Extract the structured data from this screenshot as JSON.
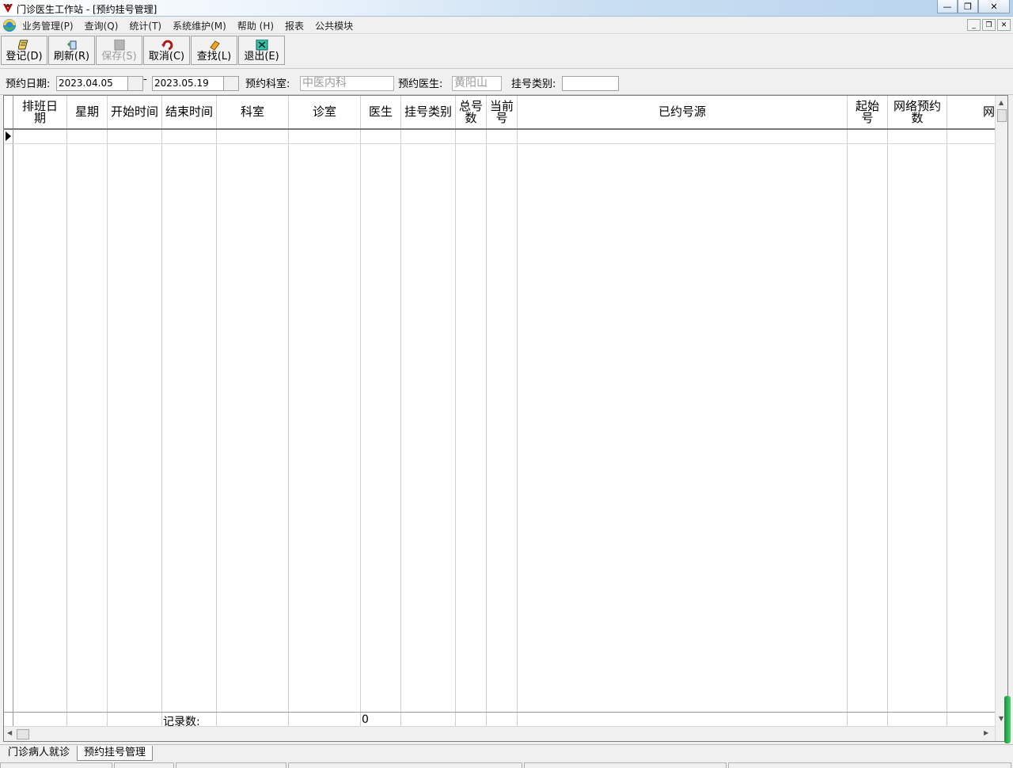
{
  "window": {
    "title": "门诊医生工作站 - [预约挂号管理]"
  },
  "menu": {
    "items": [
      "业务管理(P)",
      "查询(Q)",
      "统计(T)",
      "系统维护(M)",
      "帮助 (H)",
      "报表",
      "公共模块"
    ]
  },
  "toolbar": {
    "buttons": [
      {
        "label": "登记(D)",
        "icon": "register-icon",
        "enabled": true
      },
      {
        "label": "刷新(R)",
        "icon": "refresh-icon",
        "enabled": true
      },
      {
        "label": "保存(S)",
        "icon": "save-icon",
        "enabled": false
      },
      {
        "label": "取消(C)",
        "icon": "undo-icon",
        "enabled": true
      },
      {
        "label": "查找(L)",
        "icon": "eraser-icon",
        "enabled": true
      },
      {
        "label": "退出(E)",
        "icon": "exit-icon",
        "enabled": true
      }
    ]
  },
  "filter": {
    "date_label": "预约日期:",
    "date_from": "2023.04.05",
    "date_separator": "-",
    "date_to": "2023.05.19",
    "dept_label": "预约科室:",
    "dept_value": "中医内科",
    "doctor_label": "预约医生:",
    "doctor_value": "黄阳山",
    "regtype_label": "挂号类别:",
    "regtype_value": ""
  },
  "grid": {
    "columns": [
      "排班日\n期",
      "星期",
      "开始时间",
      "结束时间",
      "科室",
      "诊室",
      "医生",
      "挂号类别",
      "总号\n数",
      "当前\n号",
      "已约号源",
      "起始\n号",
      "网络预约\n数",
      "网"
    ],
    "footer_label": "记录数:",
    "footer_count": "0"
  },
  "tabs": [
    {
      "label": "门诊病人就诊",
      "active": false
    },
    {
      "label": "预约挂号管理",
      "active": true
    }
  ],
  "colors": {
    "title_gradient_end": "#b7d3ee",
    "scroll_green": "#2fb04f"
  }
}
